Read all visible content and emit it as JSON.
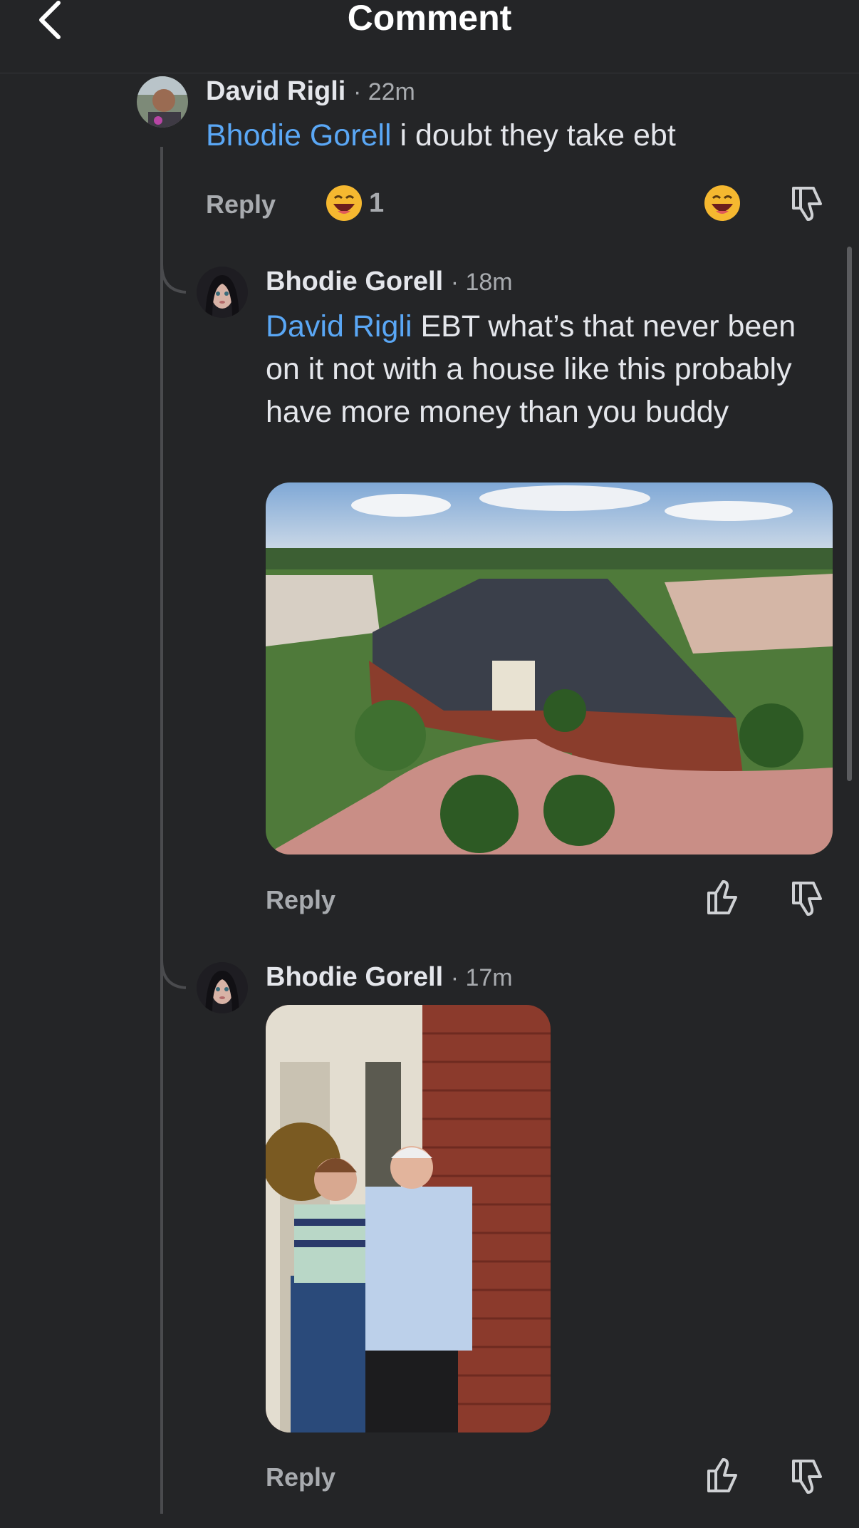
{
  "header": {
    "title": "Comment"
  },
  "comments": [
    {
      "author": "David Rigli",
      "time": "· 22m",
      "mention": "Bhodie Gorell",
      "text": " i doubt they take ebt",
      "reply_label": "Reply",
      "reaction_count": "1"
    },
    {
      "author": "Bhodie Gorell",
      "time": "· 18m",
      "mention": "David Rigli",
      "text": " EBT what’s that never been on it not with a house like this probably have more money than you buddy",
      "reply_label": "Reply"
    },
    {
      "author": "Bhodie Gorell",
      "time": "· 17m",
      "reply_label": "Reply"
    }
  ],
  "colors": {
    "background": "#242527",
    "mention": "#5aa7f5",
    "muted": "#a8abaf"
  },
  "icons": [
    "back-chevron-icon",
    "laughing-emoji-icon",
    "thumbs-up-icon",
    "thumbs-down-icon"
  ]
}
